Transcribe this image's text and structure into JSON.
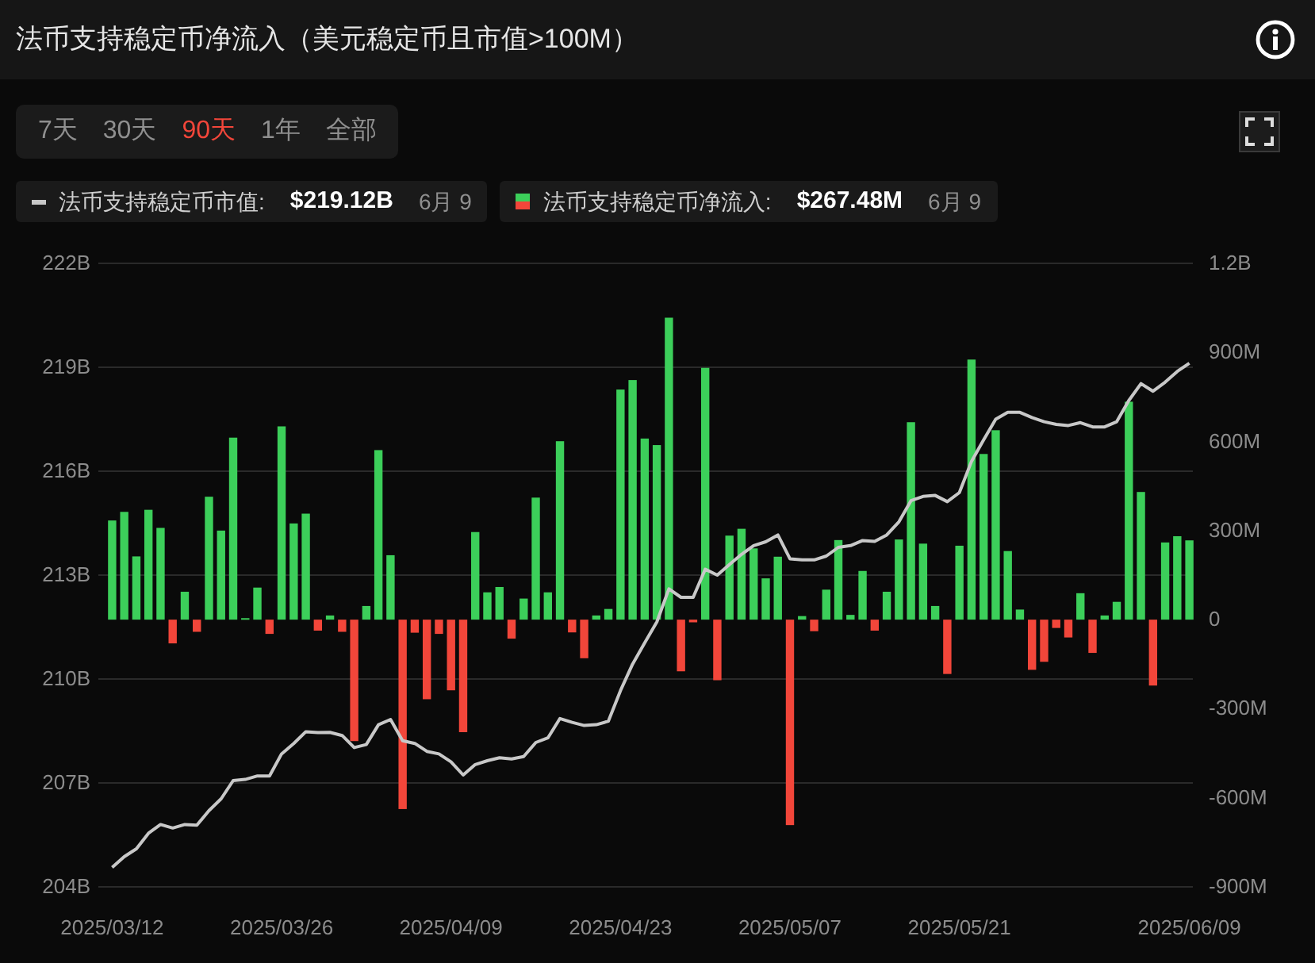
{
  "header": {
    "title": "法币支持稳定币净流入（美元稳定币且市值>100M）"
  },
  "ranges": [
    {
      "label": "7天",
      "selected": false
    },
    {
      "label": "30天",
      "selected": false
    },
    {
      "label": "90天",
      "selected": true
    },
    {
      "label": "1年",
      "selected": false
    },
    {
      "label": "全部",
      "selected": false
    }
  ],
  "legend": [
    {
      "kind": "line",
      "label": "法币支持稳定币市值:",
      "value": "$219.12B",
      "date": "6月 9"
    },
    {
      "kind": "bar",
      "label": "法币支持稳定币净流入:",
      "value": "$267.48M",
      "date": "6月 9"
    }
  ],
  "chart": {
    "chart_data": {
      "type": "bar",
      "categories": [
        "2025/03/12",
        null,
        null,
        null,
        null,
        null,
        null,
        null,
        null,
        null,
        null,
        null,
        null,
        null,
        "2025/03/26",
        null,
        null,
        null,
        null,
        null,
        null,
        null,
        null,
        null,
        null,
        null,
        null,
        null,
        "2025/04/09",
        null,
        null,
        null,
        null,
        null,
        null,
        null,
        null,
        null,
        null,
        null,
        null,
        null,
        "2025/04/23",
        null,
        null,
        null,
        null,
        null,
        null,
        null,
        null,
        null,
        null,
        null,
        null,
        null,
        "2025/05/07",
        null,
        null,
        null,
        null,
        null,
        null,
        null,
        null,
        null,
        null,
        null,
        null,
        null,
        "2025/05/21",
        null,
        null,
        null,
        null,
        null,
        null,
        null,
        null,
        null,
        null,
        null,
        null,
        null,
        null,
        null,
        null,
        null,
        null,
        "2025/06/09"
      ],
      "series": [
        {
          "color": "#3ccf5a",
          "axis": "y2",
          "values": [
            334000000,
            363000000,
            213000000,
            370000000,
            309000000,
            null,
            94000000,
            null,
            414000000,
            300000000,
            613000000,
            5000000,
            108000000,
            null,
            651000000,
            324000000,
            357000000,
            null,
            14000000,
            null,
            null,
            46000000,
            571000000,
            217000000,
            null,
            null,
            null,
            null,
            null,
            null,
            295000000,
            92000000,
            110000000,
            null,
            71000000,
            411000000,
            92000000,
            601000000,
            null,
            null,
            14000000,
            36000000,
            775000000,
            807000000,
            610000000,
            588000000,
            1017000000,
            null,
            null,
            848000000,
            null,
            283000000,
            306000000,
            240000000,
            139000000,
            212000000,
            null,
            12000000,
            null,
            101000000,
            268000000,
            16000000,
            164000000,
            null,
            94000000,
            270000000,
            665000000,
            256000000,
            46000000,
            null,
            249000000,
            876000000,
            558000000,
            638000000,
            231000000,
            34000000,
            null,
            null,
            null,
            null,
            89000000,
            null,
            14000000,
            60000000,
            734000000,
            430000000,
            null,
            260000000,
            281000000,
            267000000
          ]
        },
        {
          "color": "#f2463a",
          "axis": "y2",
          "values": [
            null,
            null,
            null,
            null,
            null,
            -80000000,
            null,
            -41000000,
            null,
            null,
            null,
            null,
            null,
            -48000000,
            null,
            null,
            null,
            -37000000,
            null,
            -41000000,
            -409000000,
            null,
            null,
            null,
            -638000000,
            -44000000,
            -268000000,
            -48000000,
            -238000000,
            -379000000,
            null,
            null,
            null,
            -64000000,
            null,
            null,
            null,
            null,
            -43000000,
            -130000000,
            null,
            null,
            null,
            null,
            null,
            null,
            null,
            -174000000,
            -9000000,
            null,
            -204000000,
            null,
            null,
            null,
            null,
            null,
            -692000000,
            null,
            -39000000,
            null,
            null,
            null,
            null,
            -37000000,
            null,
            null,
            null,
            null,
            null,
            -183000000,
            null,
            null,
            null,
            null,
            null,
            null,
            -169000000,
            -142000000,
            -28000000,
            -60000000,
            null,
            -112000000,
            null,
            null,
            null,
            null,
            -222000000,
            null,
            null,
            null
          ]
        },
        {
          "color": "#c8c8c8",
          "type": "line",
          "values": [
            204.56,
            204.87,
            205.1,
            205.55,
            205.8,
            205.7,
            205.8,
            205.78,
            206.2,
            206.54,
            207.07,
            207.1,
            207.2,
            207.2,
            207.84,
            208.14,
            208.48,
            208.45,
            208.46,
            208.37,
            208.02,
            208.11,
            208.68,
            208.83,
            208.22,
            208.14,
            207.91,
            207.84,
            207.61,
            207.23,
            207.53,
            207.64,
            207.73,
            207.69,
            207.76,
            208.17,
            208.3,
            208.86,
            208.75,
            208.66,
            208.68,
            208.78,
            209.67,
            210.43,
            211.04,
            211.65,
            212.6,
            212.36,
            212.36,
            213.17,
            213.0,
            213.3,
            213.6,
            213.85,
            213.96,
            214.16,
            213.47,
            213.44,
            213.44,
            213.55,
            213.8,
            213.85,
            214.0,
            213.97,
            214.16,
            214.54,
            215.15,
            215.27,
            215.3,
            215.12,
            215.38,
            216.29,
            216.9,
            217.5,
            217.7,
            217.7,
            217.55,
            217.43,
            217.35,
            217.32,
            217.4,
            217.28,
            217.28,
            217.43,
            218.04,
            218.53,
            218.31,
            218.57,
            218.88,
            219.12
          ]
        }
      ],
      "stacked": true,
      "grid": true,
      "ylim": [
        204,
        222
      ],
      "yticks": [
        {
          "value": 222,
          "label": "222B"
        },
        {
          "value": 219,
          "label": "219B"
        },
        {
          "value": 216,
          "label": "216B"
        },
        {
          "value": 213,
          "label": "213B"
        },
        {
          "value": 210,
          "label": "210B"
        },
        {
          "value": 207,
          "label": "207B"
        },
        {
          "value": 204,
          "label": "204B"
        }
      ],
      "y2lim": [
        -900000000,
        1200000000
      ],
      "y2ticks": [
        {
          "value": 1200000000,
          "label": "1.2B"
        },
        {
          "value": 900000000,
          "label": "900M"
        },
        {
          "value": 600000000,
          "label": "600M"
        },
        {
          "value": 300000000,
          "label": "300M"
        },
        {
          "value": 0,
          "label": "0"
        },
        {
          "value": -300000000,
          "label": "-300M"
        },
        {
          "value": -600000000,
          "label": "-600M"
        },
        {
          "value": -900000000,
          "label": "-900M"
        }
      ]
    }
  }
}
